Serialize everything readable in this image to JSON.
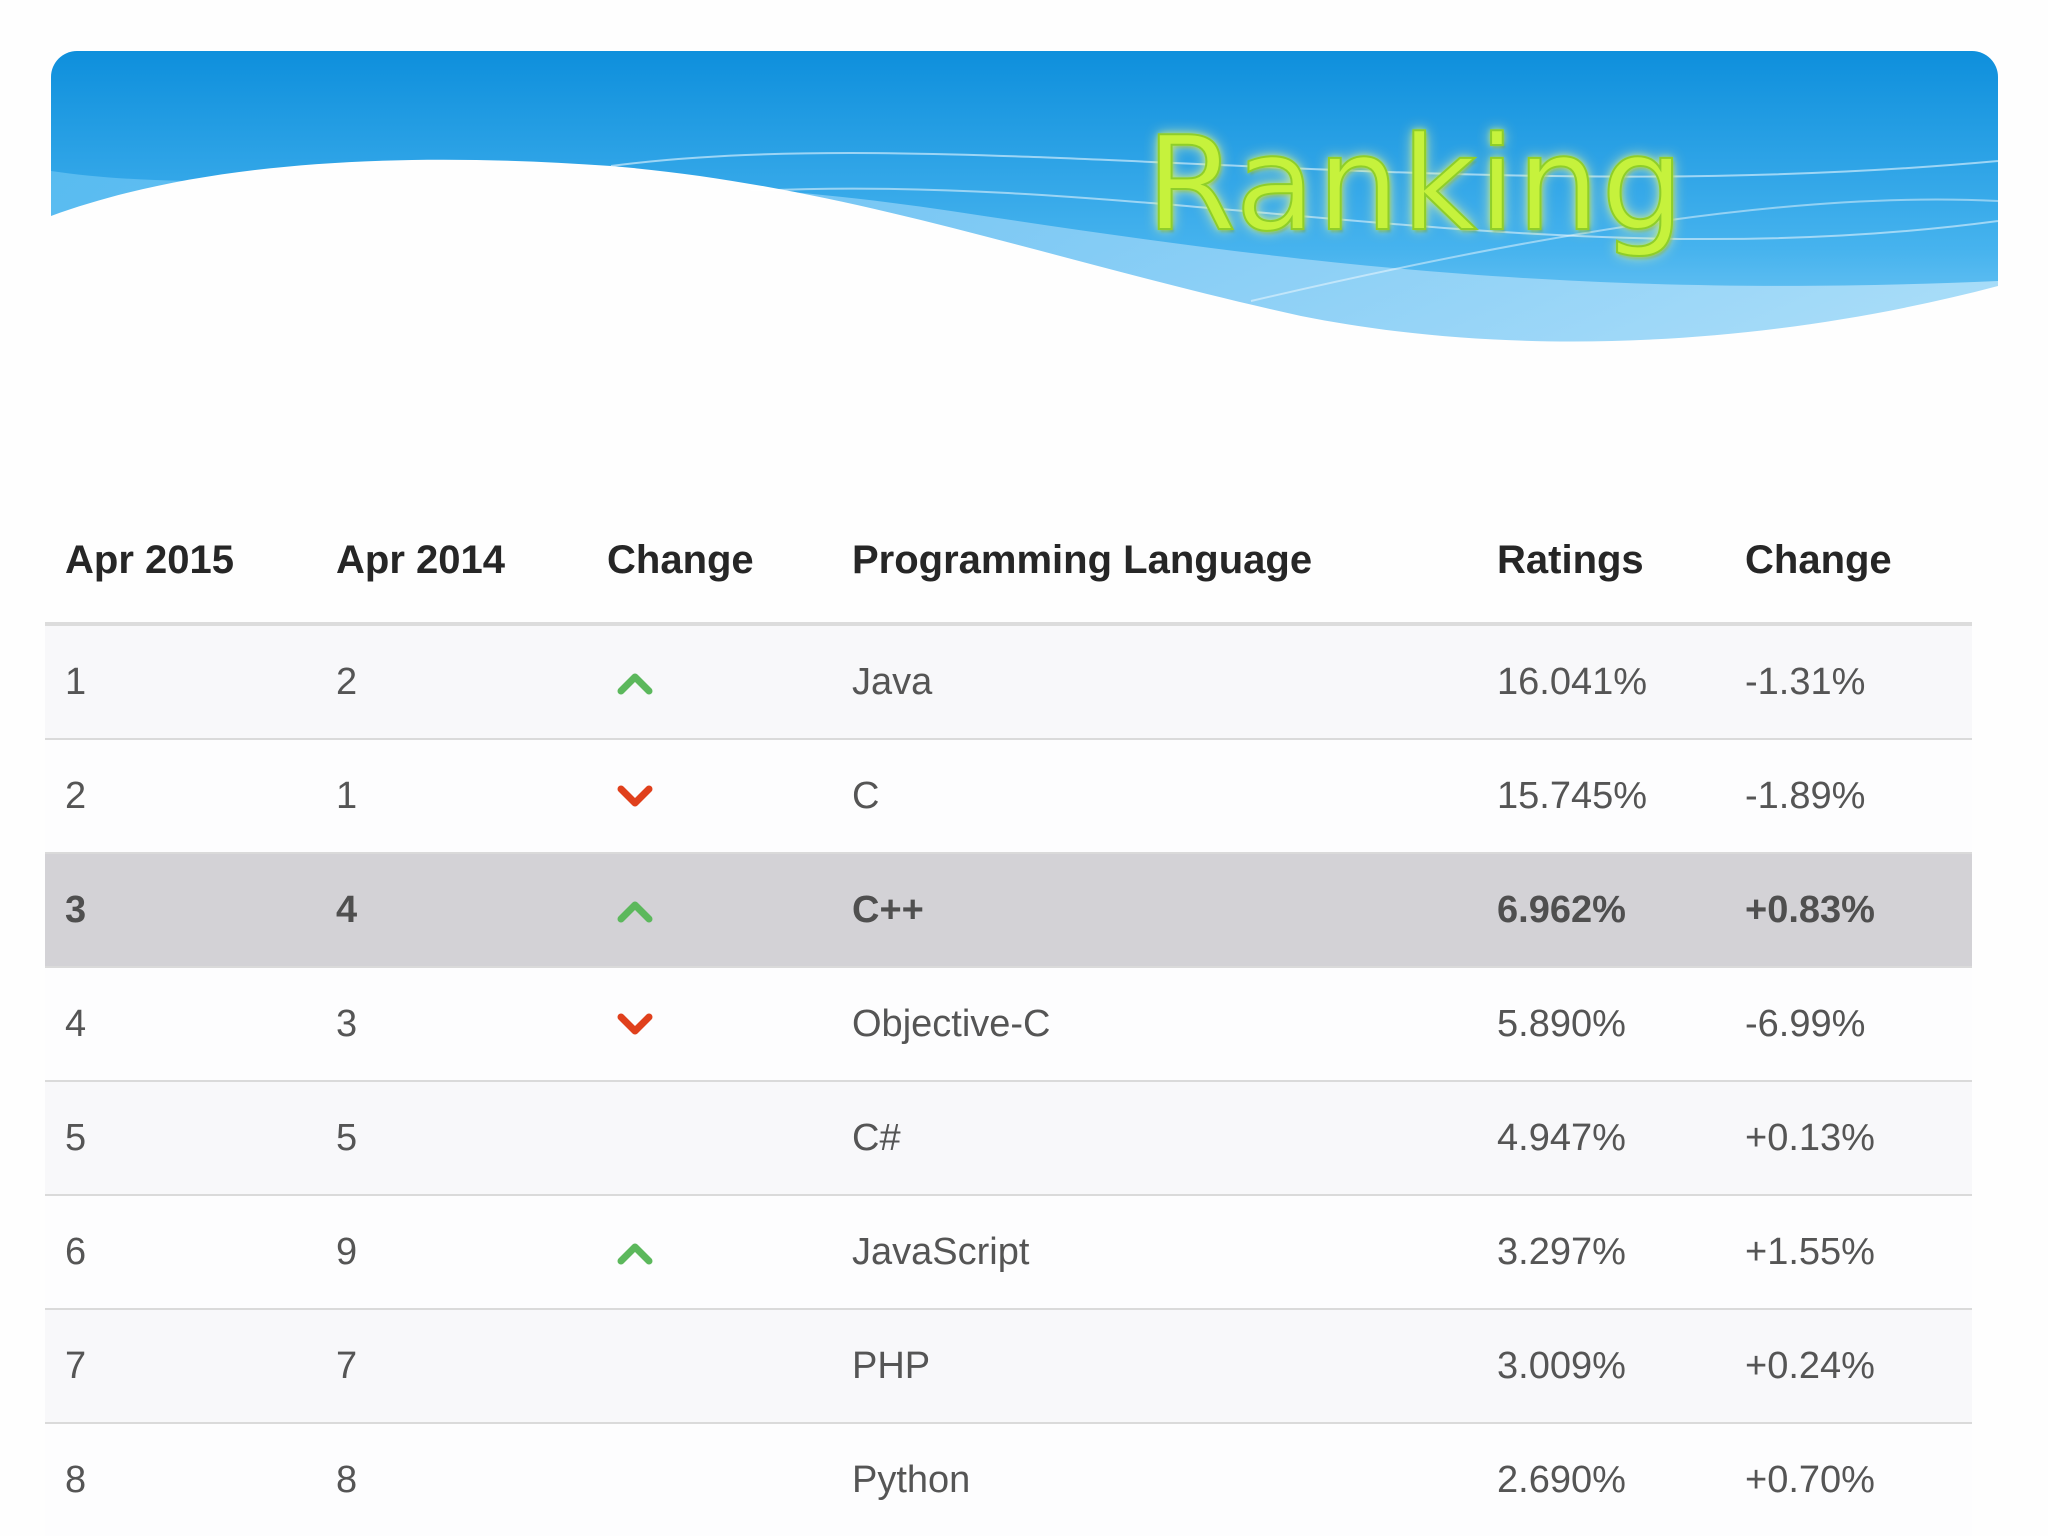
{
  "banner": {
    "title": "Ranking"
  },
  "colors": {
    "up": "#5cb85c",
    "down": "#e0401c",
    "highlight_row": "#d3d2d6",
    "banner_blue": "#1a9be3"
  },
  "table": {
    "headers": [
      "Apr 2015",
      "Apr 2014",
      "Change",
      "Programming Language",
      "Ratings",
      "Change"
    ],
    "rows": [
      {
        "rank_2015": "1",
        "rank_2014": "2",
        "change": "up-arrow-icon",
        "language": "Java",
        "rating": "16.041%",
        "delta": "-1.31%",
        "highlight": false
      },
      {
        "rank_2015": "2",
        "rank_2014": "1",
        "change": "down-arrow-icon",
        "language": "C",
        "rating": "15.745%",
        "delta": "-1.89%",
        "highlight": false
      },
      {
        "rank_2015": "3",
        "rank_2014": "4",
        "change": "up-arrow-icon",
        "language": "C++",
        "rating": "6.962%",
        "delta": "+0.83%",
        "highlight": true
      },
      {
        "rank_2015": "4",
        "rank_2014": "3",
        "change": "down-arrow-icon",
        "language": "Objective-C",
        "rating": "5.890%",
        "delta": "-6.99%",
        "highlight": false
      },
      {
        "rank_2015": "5",
        "rank_2014": "5",
        "change": "",
        "language": "C#",
        "rating": "4.947%",
        "delta": "+0.13%",
        "highlight": false
      },
      {
        "rank_2015": "6",
        "rank_2014": "9",
        "change": "up-arrow-icon",
        "language": "JavaScript",
        "rating": "3.297%",
        "delta": "+1.55%",
        "highlight": false
      },
      {
        "rank_2015": "7",
        "rank_2014": "7",
        "change": "",
        "language": "PHP",
        "rating": "3.009%",
        "delta": "+0.24%",
        "highlight": false
      },
      {
        "rank_2015": "8",
        "rank_2014": "8",
        "change": "",
        "language": "Python",
        "rating": "2.690%",
        "delta": "+0.70%",
        "highlight": false
      }
    ]
  }
}
